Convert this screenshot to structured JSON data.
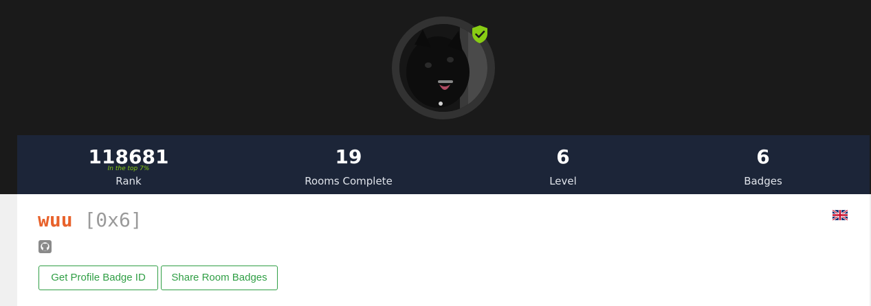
{
  "profile": {
    "avatar_alt": "black cat avatar",
    "verified_icon": "verified-shield-icon",
    "username": "wuu",
    "tag": "[0x6]",
    "country_icon": "united-kingdom-flag-icon",
    "github_icon": "github-icon"
  },
  "stats": [
    {
      "value": "118681",
      "sub": "In the top 7%",
      "label": "Rank"
    },
    {
      "value": "19",
      "label": "Rooms Complete"
    },
    {
      "value": "6",
      "label": "Level"
    },
    {
      "value": "6",
      "label": "Badges"
    }
  ],
  "actions": {
    "profile_badge_label": "Get Profile Badge ID",
    "share_badges_label": "Share Room Badges"
  },
  "colors": {
    "hero_bg": "#1a1a1a",
    "stats_bg": "#1c2538",
    "username": "#e8622b",
    "tag": "#9a9a9a",
    "rank_sub": "#88cc14",
    "button": "#2f9e44",
    "verified": "#88cc14"
  }
}
